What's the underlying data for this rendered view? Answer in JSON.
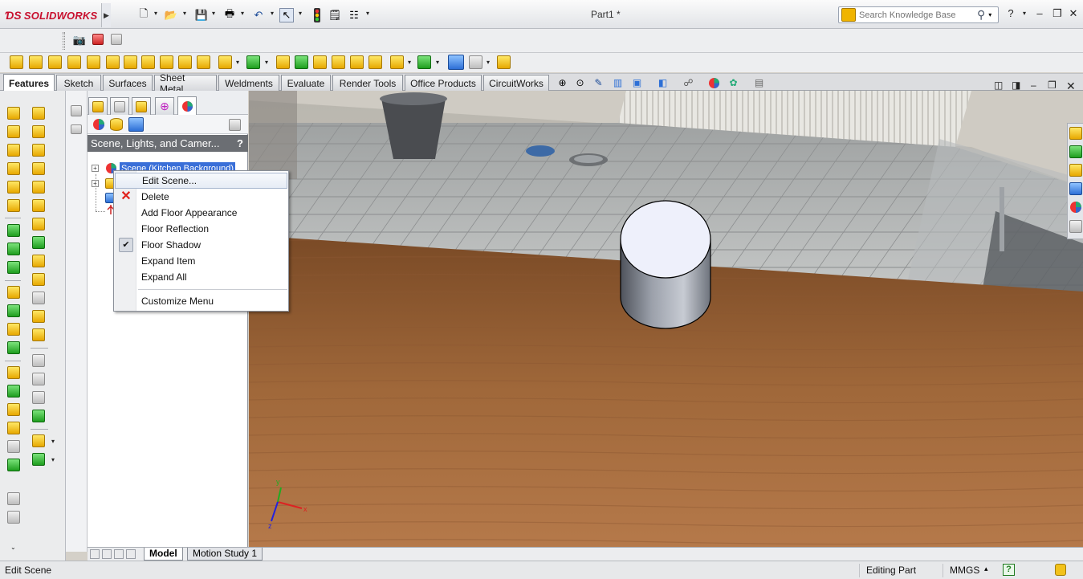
{
  "app": {
    "brand": "SOLIDWORKS",
    "document_title": "Part1 *"
  },
  "search": {
    "placeholder": "Search Knowledge Base"
  },
  "command_tabs": [
    "Features",
    "Sketch",
    "Surfaces",
    "Sheet Metal",
    "Weldments",
    "Evaluate",
    "Render Tools",
    "Office Products",
    "CircuitWorks"
  ],
  "active_command_tab": "Features",
  "feature_manager": {
    "panel_title": "Scene, Lights, and Camer...",
    "help_glyph": "?",
    "tree": {
      "selected_item": "Scene (Kitchen Background)"
    }
  },
  "context_menu": {
    "items": [
      {
        "label": "Edit Scene...",
        "highlighted": true
      },
      {
        "label": "Delete",
        "icon": "delete-x-icon"
      },
      {
        "label": "Add Floor Appearance"
      },
      {
        "label": "Floor Reflection"
      },
      {
        "label": "Floor Shadow",
        "checked": true
      },
      {
        "label": "Expand Item"
      },
      {
        "label": "Expand All"
      },
      {
        "label": "Customize Menu"
      }
    ]
  },
  "bottom_tabs": [
    "Model",
    "Motion Study 1"
  ],
  "status_bar": {
    "message": "Edit Scene",
    "mode": "Editing Part",
    "units": "MMGS",
    "units_arrow": "▴"
  },
  "colors": {
    "accent_blue": "#3a6fd8",
    "delete_red": "#e0201a",
    "brand_red": "#c8102e"
  }
}
